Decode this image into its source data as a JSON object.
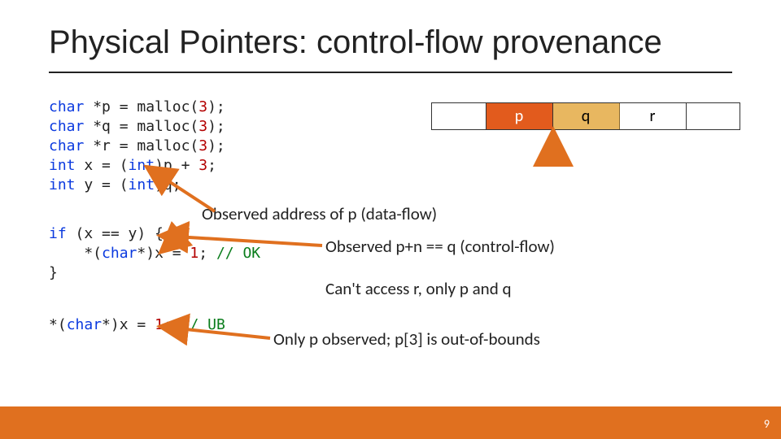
{
  "title": "Physical Pointers: control-flow provenance",
  "codeBlock1": {
    "lines": [
      {
        "kw": "char",
        "rest": " *p = malloc(",
        "num": "3",
        "tail": ");"
      },
      {
        "kw": "char",
        "rest": " *q = malloc(",
        "num": "3",
        "tail": ");"
      },
      {
        "kw": "char",
        "rest": " *r = malloc(",
        "num": "3",
        "tail": ");"
      },
      {
        "kw": "int",
        "rest": " x = (",
        "kw2": "int",
        "rest2": ")p + ",
        "num": "3",
        "tail": ";"
      },
      {
        "kw": "int",
        "rest": " y = (",
        "kw2": "int",
        "rest2": ")q;"
      }
    ]
  },
  "codeBlock2": {
    "l1a": "if",
    "l1b": " (x == y) {",
    "l2a": "    *(",
    "l2kw": "char",
    "l2b": "*)x = ",
    "l2num": "1",
    "l2c": "; ",
    "l2cm": "// OK",
    "l3": "}"
  },
  "codeBlock3": {
    "a": "*(",
    "kw": "char",
    "b": "*)x = ",
    "num": "1",
    "c": "; ",
    "cm": "// UB"
  },
  "annotations": {
    "a1": "Observed address of p (data-flow)",
    "a2": "Observed p+n == q (control-flow)",
    "a3": "Can't access r, only p and q",
    "a4": "Only p observed; p[3] is out-of-bounds"
  },
  "mem": {
    "p": "p",
    "q": "q",
    "r": "r"
  },
  "pagenum": "9"
}
